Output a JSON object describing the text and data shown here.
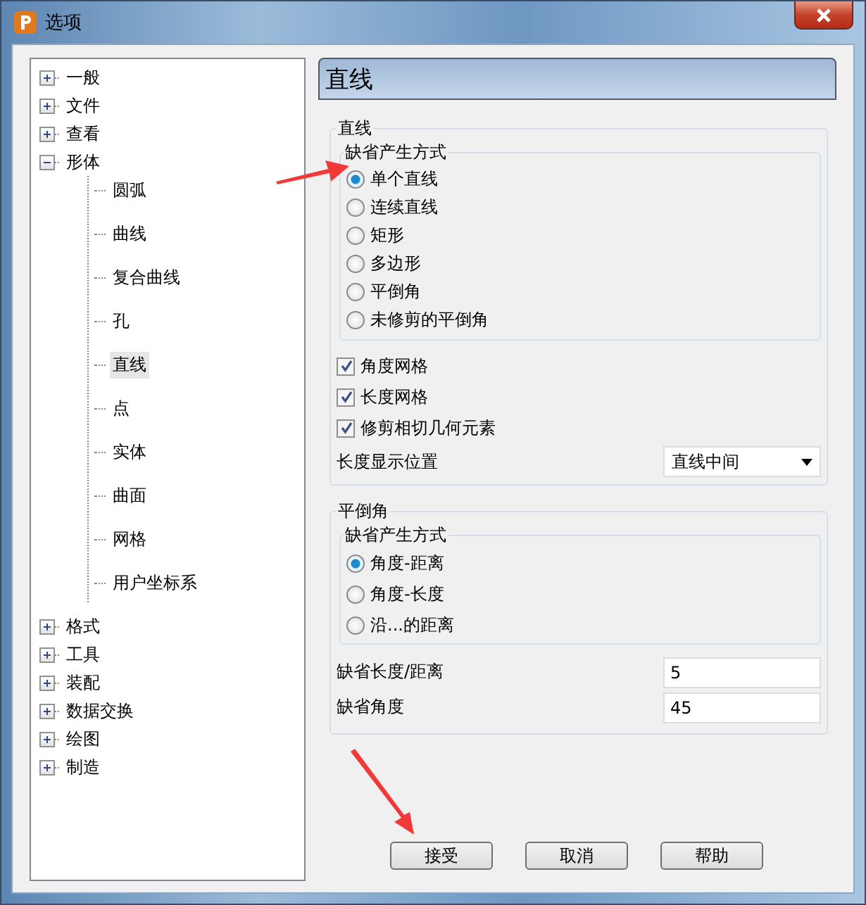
{
  "window": {
    "title": "选项"
  },
  "tree": [
    {
      "label": "一般",
      "expanded": false,
      "selected": false
    },
    {
      "label": "文件",
      "expanded": false,
      "selected": false
    },
    {
      "label": "查看",
      "expanded": false,
      "selected": false
    },
    {
      "label": "形体",
      "expanded": true,
      "selected": false,
      "children": [
        {
          "label": "圆弧",
          "selected": false
        },
        {
          "label": "曲线",
          "selected": false
        },
        {
          "label": "复合曲线",
          "selected": false
        },
        {
          "label": "孔",
          "selected": false
        },
        {
          "label": "直线",
          "selected": true
        },
        {
          "label": "点",
          "selected": false
        },
        {
          "label": "实体",
          "selected": false
        },
        {
          "label": "曲面",
          "selected": false
        },
        {
          "label": "网格",
          "selected": false
        },
        {
          "label": "用户坐标系",
          "selected": false
        }
      ]
    },
    {
      "label": "格式",
      "expanded": false,
      "selected": false
    },
    {
      "label": "工具",
      "expanded": false,
      "selected": false
    },
    {
      "label": "装配",
      "expanded": false,
      "selected": false
    },
    {
      "label": "数据交换",
      "expanded": false,
      "selected": false
    },
    {
      "label": "绘图",
      "expanded": false,
      "selected": false
    },
    {
      "label": "制造",
      "expanded": false,
      "selected": false
    }
  ],
  "panel": {
    "title": "直线",
    "line_group": {
      "title": "直线",
      "mode_group": {
        "title": "缺省产生方式",
        "options": [
          {
            "label": "单个直线",
            "selected": true
          },
          {
            "label": "连续直线",
            "selected": false
          },
          {
            "label": "矩形",
            "selected": false
          },
          {
            "label": "多边形",
            "selected": false
          },
          {
            "label": "平倒角",
            "selected": false
          },
          {
            "label": "未修剪的平倒角",
            "selected": false
          }
        ]
      },
      "checkboxes": [
        {
          "label": "角度网格",
          "checked": true
        },
        {
          "label": "长度网格",
          "checked": true
        },
        {
          "label": "修剪相切几何元素",
          "checked": true
        }
      ],
      "length_position": {
        "label": "长度显示位置",
        "value": "直线中间"
      }
    },
    "chamfer_group": {
      "title": "平倒角",
      "mode_group": {
        "title": "缺省产生方式",
        "options": [
          {
            "label": "角度-距离",
            "selected": true
          },
          {
            "label": "角度-长度",
            "selected": false
          },
          {
            "label": "沿...的距离",
            "selected": false
          }
        ]
      },
      "fields": [
        {
          "label": "缺省长度/距离",
          "value": "5"
        },
        {
          "label": "缺省角度",
          "value": "45"
        }
      ]
    }
  },
  "buttons": [
    {
      "label": "接受"
    },
    {
      "label": "取消"
    },
    {
      "label": "帮助"
    }
  ]
}
